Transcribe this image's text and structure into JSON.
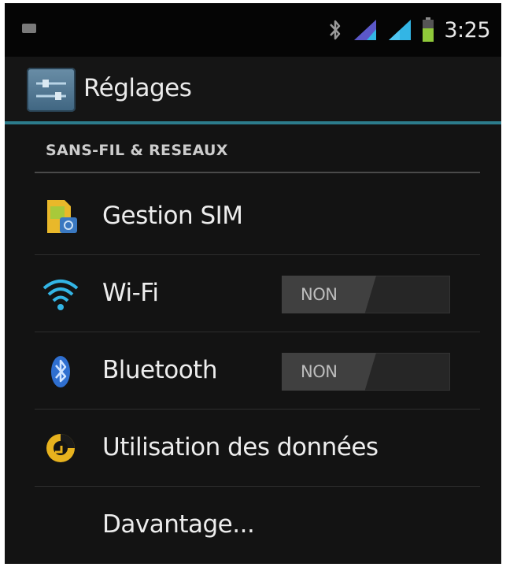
{
  "status_bar": {
    "time": "3:25",
    "icons": [
      "notification-icon",
      "bluetooth-icon",
      "signal-icon",
      "signal-icon",
      "battery-icon"
    ]
  },
  "action_bar": {
    "title": "Réglages",
    "icon": "settings-app-icon"
  },
  "section": {
    "header": "SANS-FIL & RESEAUX"
  },
  "items": [
    {
      "label": "Gestion SIM",
      "icon": "sim-card-icon"
    },
    {
      "label": "Wi-Fi",
      "icon": "wifi-icon",
      "toggle": "NON"
    },
    {
      "label": "Bluetooth",
      "icon": "bluetooth-icon",
      "toggle": "NON"
    },
    {
      "label": "Utilisation des données",
      "icon": "data-usage-icon"
    },
    {
      "label": "Davantage..."
    }
  ],
  "colors": {
    "accent": "#2c7c8c",
    "background": "#131313",
    "text": "#ededed"
  }
}
